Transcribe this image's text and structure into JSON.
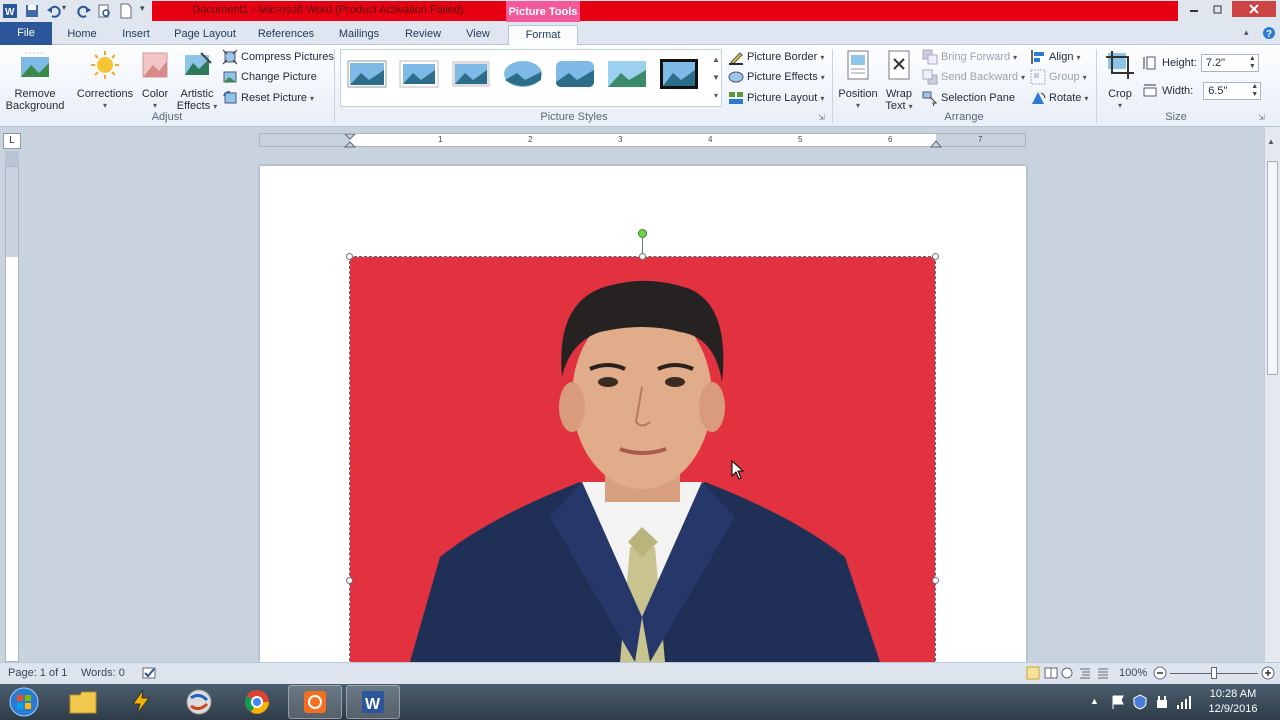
{
  "window": {
    "title": "Document1 - Microsoft Word (Product Activation Failed)",
    "contextual_tab": "Picture Tools",
    "colors": {
      "title_red": "#e60012",
      "contextual_pink": "#f25a9a",
      "file_tab": "#2b579a",
      "photo_bg": "#e2323f"
    }
  },
  "tabs": [
    {
      "label": "File"
    },
    {
      "label": "Home"
    },
    {
      "label": "Insert"
    },
    {
      "label": "Page Layout"
    },
    {
      "label": "References"
    },
    {
      "label": "Mailings"
    },
    {
      "label": "Review"
    },
    {
      "label": "View"
    },
    {
      "label": "Format"
    }
  ],
  "ribbon": {
    "adjust": {
      "label": "Adjust",
      "remove_background_1": "Remove",
      "remove_background_2": "Background",
      "corrections": "Corrections",
      "color": "Color",
      "artistic_effects_1": "Artistic",
      "artistic_effects_2": "Effects",
      "compress": "Compress Pictures",
      "change": "Change Picture",
      "reset": "Reset Picture"
    },
    "picture_styles": {
      "label": "Picture Styles",
      "border": "Picture Border",
      "effects": "Picture Effects",
      "layout": "Picture Layout"
    },
    "arrange": {
      "label": "Arrange",
      "position": "Position",
      "wrap_1": "Wrap",
      "wrap_2": "Text",
      "bring_forward": "Bring Forward",
      "send_backward": "Send Backward",
      "selection_pane": "Selection Pane",
      "align": "Align",
      "group": "Group",
      "rotate": "Rotate"
    },
    "size": {
      "label": "Size",
      "crop": "Crop",
      "height_label": "Height:",
      "height_value": "7.2\"",
      "width_label": "Width:",
      "width_value": "6.5\""
    }
  },
  "ruler": {
    "numbers": [
      "1",
      "2",
      "3",
      "4",
      "5",
      "6",
      "7"
    ],
    "corner": "L"
  },
  "status": {
    "page": "Page: 1 of 1",
    "words": "Words: 0",
    "zoom": "100%"
  },
  "taskbar": {
    "time": "10:28 AM",
    "date": "12/9/2016"
  }
}
